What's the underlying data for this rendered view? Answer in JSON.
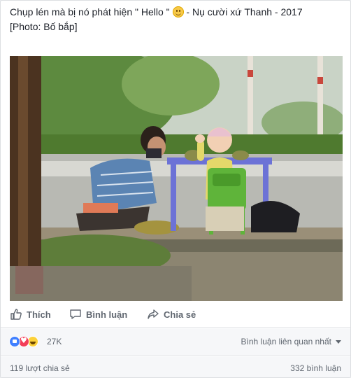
{
  "post": {
    "caption_line1_text": "Chụp lén mà bị nó phát hiện \" Hello \"",
    "caption_line1_suffix": " - Nụ cười xứ Thanh - 2017",
    "caption_line2": "[Photo: Bố bắp]",
    "emoji_icon": "slightly-smiling-face-icon",
    "photo_icon": "photo-image"
  },
  "actions": {
    "like_label": "Thích",
    "comment_label": "Bình luận",
    "share_label": "Chia sẻ"
  },
  "reactions": {
    "icons": [
      "like-icon",
      "love-icon",
      "haha-icon"
    ],
    "count": "27K",
    "related_comments_label": "Bình luận liên quan nhất"
  },
  "stats": {
    "shares": "119 lượt chia sẻ",
    "comments": "332 bình luận"
  },
  "colors": {
    "like_blue": "#4080ff",
    "love_red": "#f33e58",
    "haha_yellow": "#fcd13a",
    "text_secondary": "#606770"
  }
}
